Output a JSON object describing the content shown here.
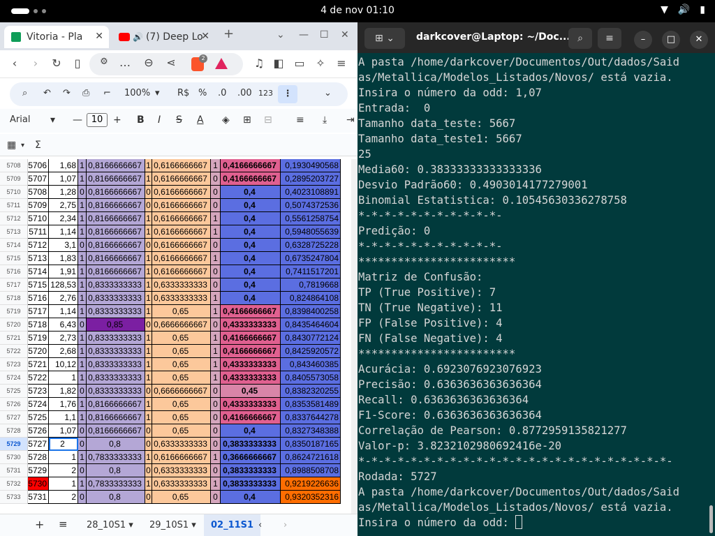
{
  "system": {
    "date_time": "4 de nov  01:10"
  },
  "browser": {
    "tabs": [
      {
        "label": "Vitoria - Pla"
      },
      {
        "label": "(7) Deep Lo"
      }
    ],
    "new_tab_symbol": "+",
    "shield_badge": "2"
  },
  "sheets": {
    "toolbar": {
      "zoom": "100%",
      "currency": "R$",
      "percent": "%",
      "dec_minus": ".0",
      "dec_plus": ".00",
      "number_format": "123"
    },
    "fontbar": {
      "font": "Arial",
      "size": "10"
    },
    "formula": {
      "sum": "Σ"
    },
    "rows": [
      {
        "rn": "5708",
        "a": "5706",
        "b": "1,68",
        "c": "1",
        "d": "0,8166666667",
        "e": "1",
        "f": "0,6166666667",
        "g": "1",
        "h": "0,4166666667",
        "i": "0,1930490568"
      },
      {
        "rn": "5709",
        "a": "5707",
        "b": "1,07",
        "c": "1",
        "d": "0,8166666667",
        "e": "1",
        "f": "0,6166666667",
        "g": "0",
        "h": "0,4166666667",
        "i": "0,2895203727"
      },
      {
        "rn": "5710",
        "a": "5708",
        "b": "1,28",
        "c": "0",
        "d": "0,8166666667",
        "e": "0",
        "f": "0,6166666667",
        "g": "0",
        "h": "0,4",
        "i": "0,4023108891"
      },
      {
        "rn": "5711",
        "a": "5709",
        "b": "2,75",
        "c": "1",
        "d": "0,8166666667",
        "e": "0",
        "f": "0,6166666667",
        "g": "0",
        "h": "0,4",
        "i": "0,5074372536"
      },
      {
        "rn": "5712",
        "a": "5710",
        "b": "2,34",
        "c": "1",
        "d": "0,8166666667",
        "e": "1",
        "f": "0,6166666667",
        "g": "1",
        "h": "0,4",
        "i": "0,5561258754"
      },
      {
        "rn": "5713",
        "a": "5711",
        "b": "1,14",
        "c": "1",
        "d": "0,8166666667",
        "e": "1",
        "f": "0,6166666667",
        "g": "1",
        "h": "0,4",
        "i": "0,5948055639"
      },
      {
        "rn": "5714",
        "a": "5712",
        "b": "3,1",
        "c": "0",
        "d": "0,8166666667",
        "e": "0",
        "f": "0,6166666667",
        "g": "0",
        "h": "0,4",
        "i": "0,6328725228"
      },
      {
        "rn": "5715",
        "a": "5713",
        "b": "1,83",
        "c": "1",
        "d": "0,8166666667",
        "e": "1",
        "f": "0,6166666667",
        "g": "1",
        "h": "0,4",
        "i": "0,6735247804"
      },
      {
        "rn": "5716",
        "a": "5714",
        "b": "1,91",
        "c": "1",
        "d": "0,8166666667",
        "e": "1",
        "f": "0,6166666667",
        "g": "0",
        "h": "0,4",
        "i": "0,7411517201"
      },
      {
        "rn": "5717",
        "a": "5715",
        "b": "128,53",
        "c": "1",
        "d": "0,8333333333",
        "e": "1",
        "f": "0,6333333333",
        "g": "0",
        "h": "0,4",
        "i": "0,7819668"
      },
      {
        "rn": "5718",
        "a": "5716",
        "b": "2,76",
        "c": "1",
        "d": "0,8333333333",
        "e": "1",
        "f": "0,6333333333",
        "g": "1",
        "h": "0,4",
        "i": "0,824864108"
      },
      {
        "rn": "5719",
        "a": "5717",
        "b": "1,14",
        "c": "1",
        "d": "0,8333333333",
        "e": "1",
        "f": "0,65",
        "g": "1",
        "h": "0,4166666667",
        "i": "0,8398400258"
      },
      {
        "rn": "5720",
        "a": "5718",
        "b": "6,43",
        "c": "0",
        "d": "0,85",
        "e": "0",
        "f": "0,6666666667",
        "g": "0",
        "h": "0,4333333333",
        "i": "0,8435464604"
      },
      {
        "rn": "5721",
        "a": "5719",
        "b": "2,73",
        "c": "1",
        "d": "0,8333333333",
        "e": "1",
        "f": "0,65",
        "g": "1",
        "h": "0,4166666667",
        "i": "0,8430772124"
      },
      {
        "rn": "5722",
        "a": "5720",
        "b": "2,68",
        "c": "1",
        "d": "0,8333333333",
        "e": "1",
        "f": "0,65",
        "g": "1",
        "h": "0,4166666667",
        "i": "0,8425920572"
      },
      {
        "rn": "5723",
        "a": "5721",
        "b": "10,12",
        "c": "1",
        "d": "0,8333333333",
        "e": "1",
        "f": "0,65",
        "g": "1",
        "h": "0,4333333333",
        "i": "0,843460385"
      },
      {
        "rn": "5724",
        "a": "5722",
        "b": "1",
        "c": "1",
        "d": "0,8333333333",
        "e": "1",
        "f": "0,65",
        "g": "1",
        "h": "0,4333333333",
        "i": "0,8405573058"
      },
      {
        "rn": "5725",
        "a": "5723",
        "b": "1,82",
        "c": "0",
        "d": "0,8333333333",
        "e": "0",
        "f": "0,6666666667",
        "g": "0",
        "h": "0,45",
        "i": "0,8382320255"
      },
      {
        "rn": "5726",
        "a": "5724",
        "b": "1,76",
        "c": "1",
        "d": "0,8166666667",
        "e": "1",
        "f": "0,65",
        "g": "0",
        "h": "0,4333333333",
        "i": "0,8353581489"
      },
      {
        "rn": "5727",
        "a": "5725",
        "b": "1,1",
        "c": "1",
        "d": "0,8166666667",
        "e": "1",
        "f": "0,65",
        "g": "0",
        "h": "0,4166666667",
        "i": "0,8337644278"
      },
      {
        "rn": "5728",
        "a": "5726",
        "b": "1,07",
        "c": "0",
        "d": "0,8166666667",
        "e": "0",
        "f": "0,65",
        "g": "0",
        "h": "0,4",
        "i": "0,8327348388"
      },
      {
        "rn": "5729",
        "a": "5727",
        "b": "2",
        "c": "0",
        "d": "0,8",
        "e": "0",
        "f": "0,6333333333",
        "g": "0",
        "h": "0,3833333333",
        "i": "0,8350187165"
      },
      {
        "rn": "5730",
        "a": "5728",
        "b": "1",
        "c": "1",
        "d": "0,7833333333",
        "e": "1",
        "f": "0,6166666667",
        "g": "1",
        "h": "0,3666666667",
        "i": "0,8624721618"
      },
      {
        "rn": "5731",
        "a": "5729",
        "b": "2",
        "c": "0",
        "d": "0,8",
        "e": "0",
        "f": "0,6333333333",
        "g": "0",
        "h": "0,3833333333",
        "i": "0,8988508708"
      },
      {
        "rn": "5732",
        "a": "5730",
        "b": "1",
        "c": "1",
        "d": "0,7833333333",
        "e": "1",
        "f": "0,6333333333",
        "g": "1",
        "h": "0,3833333333",
        "i": "0,9219226636"
      },
      {
        "rn": "5733",
        "a": "5731",
        "b": "2",
        "c": "0",
        "d": "0,8",
        "e": "0",
        "f": "0,65",
        "g": "0",
        "h": "0,4",
        "i": "0,9320352316"
      }
    ],
    "selected_row": "5729",
    "sheet_tabs": [
      {
        "label": "28_10S1"
      },
      {
        "label": "29_10S1"
      },
      {
        "label": "02_11S1"
      }
    ]
  },
  "terminal": {
    "title": "darkcover@Laptop: ~/Doc...",
    "lines": [
      "A pasta /home/darkcover/Documentos/Out/dados/Said",
      "as/Metallica/Modelos_Listados/Novos/ está vazia.",
      "Insira o número da odd: 1,07",
      "Entrada:  0",
      "Tamanho data_teste: 5667",
      "Tamanho data_teste1: 5667",
      "25",
      "Media60: 0.38333333333333336",
      "Desvio Padrão60: 0.4903014177279001",
      "Binomial Estatistica: 0.10545630336278758",
      "*-*-*-*-*-*-*-*-*-*-*-",
      "Predição: 0",
      "*-*-*-*-*-*-*-*-*-*-*-",
      "************************",
      "Matriz de Confusão:",
      "TP (True Positive): 7",
      "TN (True Negative): 11",
      "FP (False Positive): 4",
      "FN (False Negative): 4",
      "************************",
      "Acurácia: 0.6923076923076923",
      "Precisão: 0.6363636363636364",
      "Recall: 0.6363636363636364",
      "F1-Score: 0.6363636363636364",
      "Correlação de Pearson: 0.8772959135821277",
      "Valor-p: 3.8232102980692416e-20",
      "*-*-*-*-*-*-*-*-*-*-*-*-*-*-*-*-*-*-*-*-*-*-*-*-",
      "Rodada: 5727",
      "A pasta /home/darkcover/Documentos/Out/dados/Said",
      "as/Metallica/Modelos_Listados/Novos/ está vazia."
    ],
    "prompt": "Insira o número da odd: "
  },
  "colors": {
    "col_c_bg": "#b4a7d6",
    "col_d_bg": "#b4a7d6",
    "col_d_hi": "#7b1fa2",
    "col_f_bg": "#fcc89b",
    "col_g_bg": "#d5a6bd",
    "col_h_bg": "#5b6ee1",
    "col_h_pink": "#e06090",
    "col_i_bg": "#5b6ee1",
    "col_i_orange": "#ff6d01",
    "red_cell": "#ff0000"
  }
}
